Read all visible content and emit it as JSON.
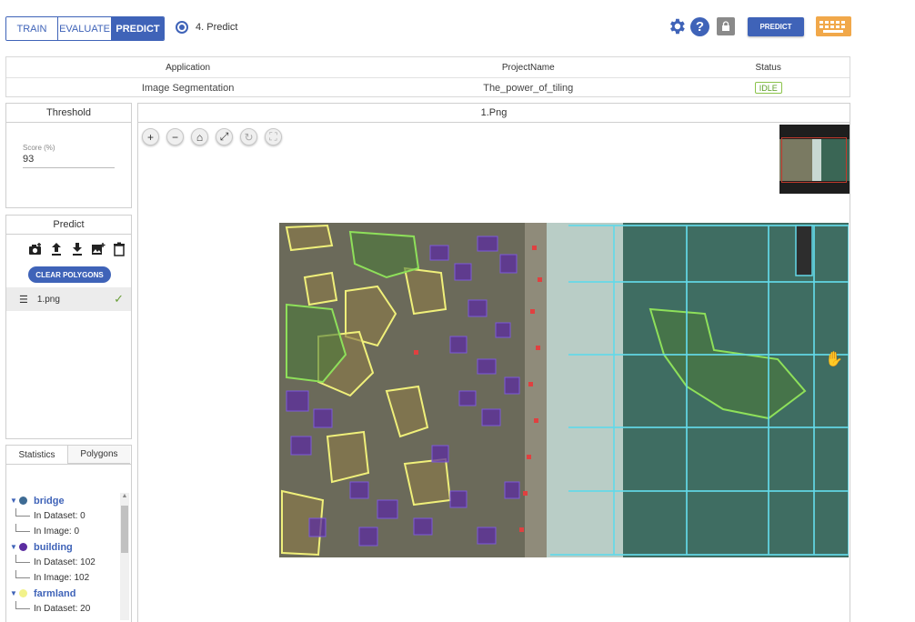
{
  "header": {
    "tabs": [
      {
        "label": "TRAIN",
        "active": false
      },
      {
        "label": "EVALUATE",
        "active": false
      },
      {
        "label": "PREDICT",
        "active": true
      }
    ],
    "step_label": "4. Predict",
    "predict_button": "PREDICT",
    "icons": [
      "gear-icon",
      "help-icon",
      "lock-icon",
      "keyboard-icon"
    ],
    "accent_color": "#3f63b8"
  },
  "info_table": {
    "headers": [
      "Application",
      "ProjectName",
      "Status"
    ],
    "values": [
      "Image Segmentation",
      "The_power_of_tiling",
      "IDLE"
    ]
  },
  "threshold": {
    "title": "Threshold",
    "score_label": "Score (%)",
    "score_value": "93"
  },
  "predict_panel": {
    "title": "Predict",
    "icons": [
      "camera-add-icon",
      "upload-icon",
      "download-icon",
      "add-image-icon",
      "trash-icon"
    ],
    "clear_button": "CLEAR POLYGONS",
    "files": [
      {
        "name": "1.png",
        "done": true
      }
    ]
  },
  "stats_panel": {
    "tabs": [
      "Statistics",
      "Polygons"
    ],
    "classes": [
      {
        "name": "bridge",
        "color": "#3e6b94",
        "in_dataset": "In Dataset: 0",
        "in_image": "In Image: 0"
      },
      {
        "name": "building",
        "color": "#5b2ca0",
        "in_dataset": "In Dataset: 102",
        "in_image": "In Image: 102"
      },
      {
        "name": "farmland",
        "color": "#f2f28a",
        "in_dataset": "In Dataset: 20"
      }
    ]
  },
  "viewer": {
    "title": "1.Png",
    "tools": [
      "zoom-in-icon",
      "zoom-out-icon",
      "home-icon",
      "fit-icon",
      "rotate-icon",
      "fullscreen-icon"
    ]
  }
}
